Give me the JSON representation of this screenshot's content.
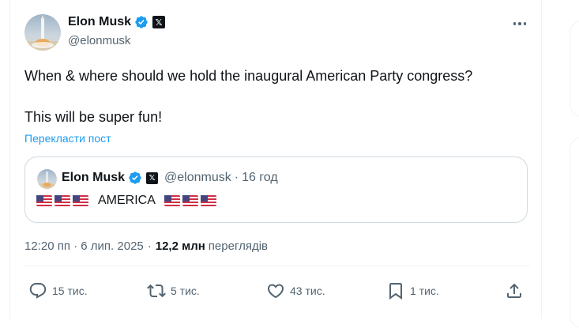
{
  "tweet": {
    "author_name": "Elon Musk",
    "author_handle": "@elonmusk",
    "x_badge": "𝕏",
    "text_line_1": "When & where should we hold the inaugural American Party congress?",
    "text_line_2": "This will be super fun!",
    "translate_label": "Перекласти пост",
    "timestamp": "12:20 пп · 6 лип. 2025",
    "meta_separator": "·",
    "views_count": "12,2 млн",
    "views_label": "переглядів"
  },
  "quoted_tweet": {
    "author_name": "Elon Musk",
    "author_handle": "@elonmusk",
    "x_badge": "𝕏",
    "separator": "·",
    "time_ago": "16 год",
    "text": "AMERICA"
  },
  "actions": {
    "replies": "15 тис.",
    "reposts": "5 тис.",
    "likes": "43 тис.",
    "bookmarks": "1 тис."
  },
  "icons": [
    "verified-badge-icon",
    "more-options-icon",
    "reply-icon",
    "repost-icon",
    "like-icon",
    "bookmark-icon",
    "share-icon",
    "us-flag-icon"
  ],
  "colors": {
    "accent": "#1d9bf0",
    "text": "#0f1419",
    "secondary": "#536471",
    "border": "#cfd9de"
  }
}
